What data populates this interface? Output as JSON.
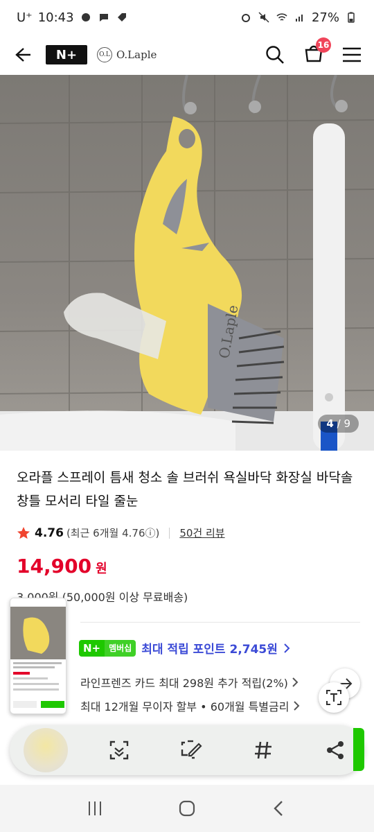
{
  "status_bar": {
    "carrier": "U⁺",
    "time": "10:43",
    "battery": "27%"
  },
  "header": {
    "nplus_logo": "N+",
    "brand_badge": "O.L",
    "brand_name": "O.Laple",
    "cart_count": "16"
  },
  "gallery": {
    "current": "4",
    "total": "/ 9"
  },
  "product": {
    "title": "오라플 스프레이 틈새 청소 솔 브러쉬 욕실바닥 화장실 바닥솔 창틀 모서리 타일 줄눈",
    "rating": "4.76",
    "rating_detail": "(최근 6개월 4.76ⓘ)",
    "reviews": "50건 리뷰",
    "price": "14,900",
    "price_unit": "원",
    "shipping": "3,000원 (50,000원 이상 무료배송)"
  },
  "benefits": {
    "badge_n": "N+",
    "badge_member": "멤버십",
    "point": "최대 적립 포인트 2,745원",
    "card": "라인프렌즈 카드 최대 298원 추가 적립(2%)",
    "installment": "최대 12개월 무이자 할부 • 60개월 특별금리"
  },
  "colors": {
    "price_red": "#e3002a",
    "point_blue": "#3b4ad6",
    "naver_green": "#1ec800",
    "badge_red": "#f0455a"
  },
  "icons": [
    "back-arrow-icon",
    "search-icon",
    "cart-icon",
    "menu-icon",
    "star-icon",
    "share-icon",
    "text-extract-icon",
    "scan-icon",
    "edit-screenshot-icon",
    "hashtag-icon"
  ]
}
